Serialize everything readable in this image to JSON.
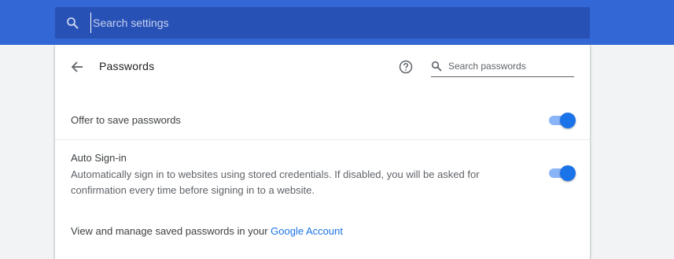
{
  "top_search": {
    "placeholder": "Search settings",
    "icon": "search-icon"
  },
  "header": {
    "back_icon": "arrow-back-icon",
    "title": "Passwords",
    "help_icon": "help-circle-icon",
    "search_placeholder": "Search passwords",
    "search_icon": "search-icon"
  },
  "settings": {
    "offer_save": {
      "label": "Offer to save passwords",
      "enabled": true
    },
    "auto_signin": {
      "label": "Auto Sign-in",
      "description": "Automatically sign in to websites using stored credentials. If disabled, you will be asked for confirmation every time before signing in to a website.",
      "enabled": true
    }
  },
  "manage": {
    "text": "View and manage saved passwords in your ",
    "link_text": "Google Account"
  },
  "colors": {
    "topbar": "#3367d6",
    "search_box": "#2851b5",
    "accent": "#1a73e8",
    "toggle_track": "#8ab4f8",
    "page_bg": "#f1f3f4"
  }
}
